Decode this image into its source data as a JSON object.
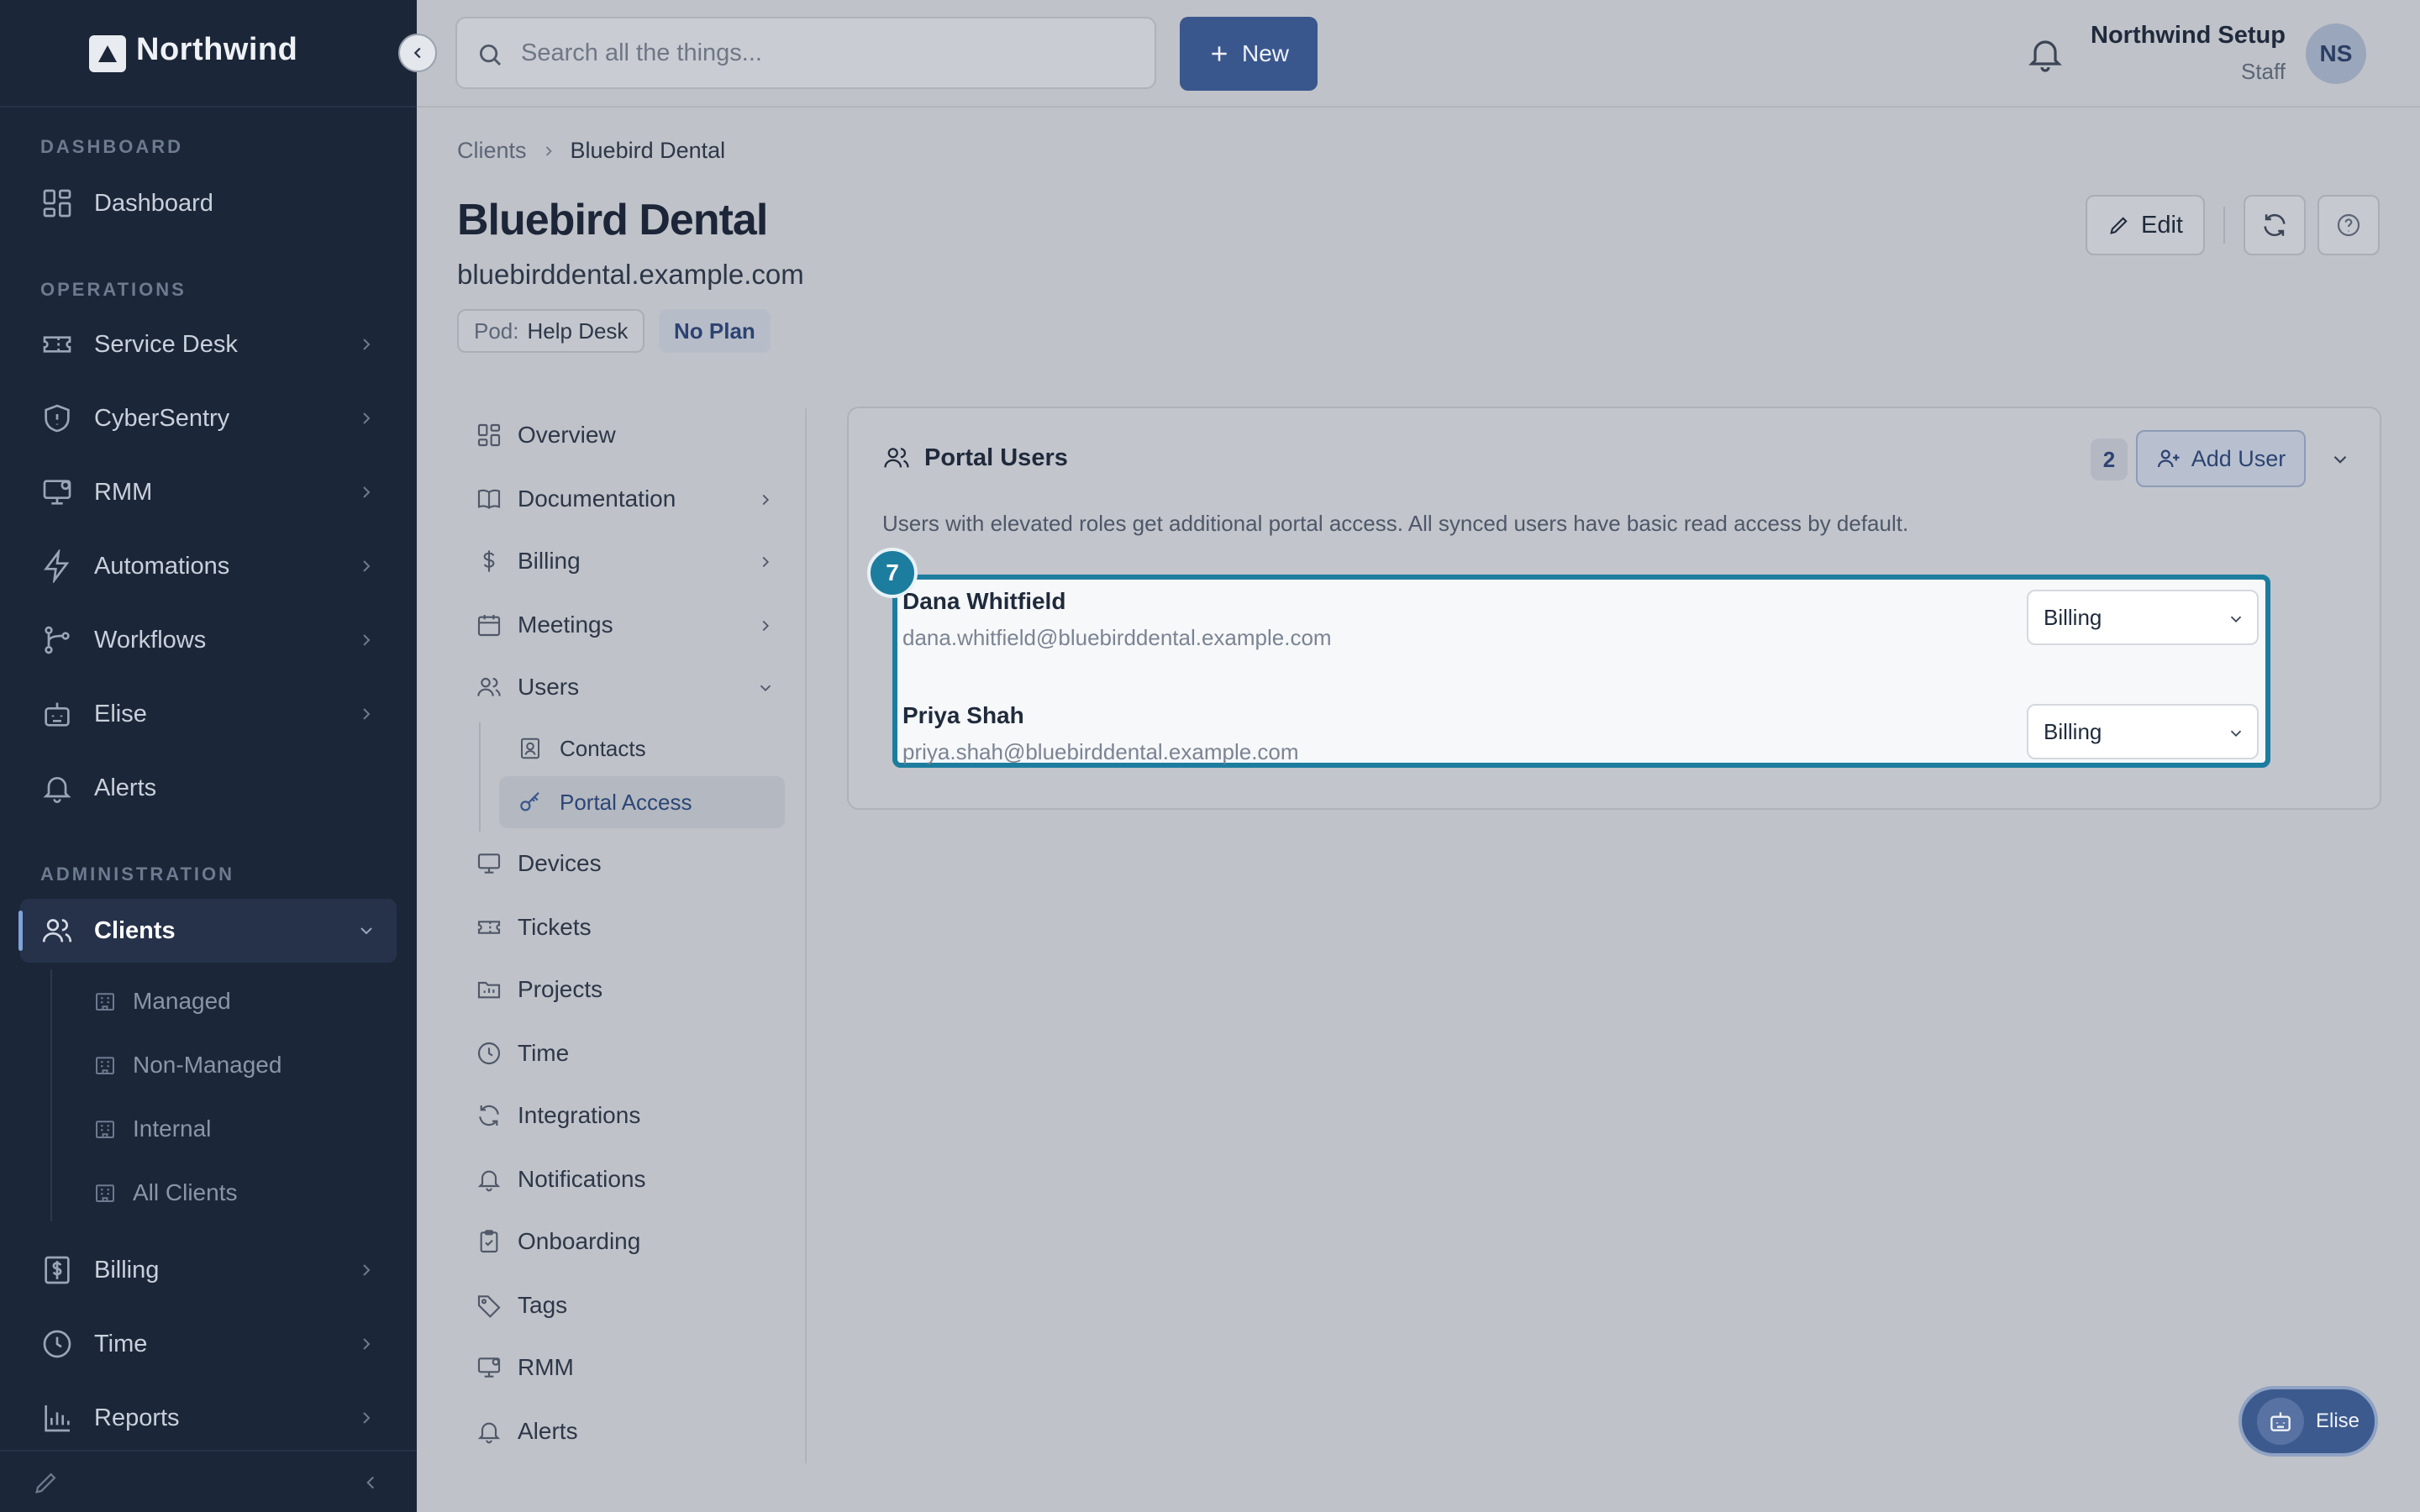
{
  "app": {
    "name": "Northwind"
  },
  "colors": {
    "sidebar_bg": "#1b2638",
    "accent": "#3a578d",
    "highlight": "#1d7d9e",
    "overlay_bg": "#bfc2c8"
  },
  "sidebar": {
    "sections": {
      "dashboard": "DASHBOARD",
      "operations": "OPERATIONS",
      "administration": "ADMINISTRATION"
    },
    "items": {
      "dashboard": {
        "label": "Dashboard",
        "icon": "dashboard-icon"
      },
      "service_desk": {
        "label": "Service Desk",
        "icon": "ticket-icon"
      },
      "cybersentry": {
        "label": "CyberSentry",
        "icon": "shield-icon"
      },
      "rmm": {
        "label": "RMM",
        "icon": "monitor-icon"
      },
      "automations": {
        "label": "Automations",
        "icon": "lightning-icon"
      },
      "workflows": {
        "label": "Workflows",
        "icon": "workflow-icon"
      },
      "elise": {
        "label": "Elise",
        "icon": "bot-icon"
      },
      "alerts": {
        "label": "Alerts",
        "icon": "bell-icon"
      },
      "clients": {
        "label": "Clients",
        "icon": "users-icon"
      },
      "billing": {
        "label": "Billing",
        "icon": "dollar-icon"
      },
      "time": {
        "label": "Time",
        "icon": "clock-icon"
      },
      "reports": {
        "label": "Reports",
        "icon": "chart-icon"
      }
    },
    "clients_sub": [
      "Managed",
      "Non-Managed",
      "Internal",
      "All Clients"
    ]
  },
  "topbar": {
    "search_placeholder": "Search all the things...",
    "new_label": "New",
    "user_name": "Northwind Setup",
    "user_role": "Staff",
    "avatar_initials": "NS"
  },
  "breadcrumb": [
    "Clients",
    "Bluebird Dental"
  ],
  "client": {
    "name": "Bluebird Dental",
    "domain": "bluebirddental.example.com",
    "pod_key": "Pod:",
    "pod_value": "Help Desk",
    "plan": "No Plan",
    "edit_label": "Edit"
  },
  "subnav": {
    "items": [
      "Overview",
      "Documentation",
      "Billing",
      "Meetings",
      "Users",
      "Devices",
      "Tickets",
      "Projects",
      "Time",
      "Integrations",
      "Notifications",
      "Onboarding",
      "Tags",
      "RMM",
      "Alerts"
    ],
    "users_sub": [
      "Contacts",
      "Portal Access"
    ]
  },
  "portal_users": {
    "title": "Portal Users",
    "count": "2",
    "add_label": "Add User",
    "description": "Users with elevated roles get additional portal access. All synced users have basic read access by default.",
    "step": "7",
    "users": [
      {
        "name": "Dana Whitfield",
        "email": "dana.whitfield@bluebirddental.example.com",
        "role": "Billing"
      },
      {
        "name": "Priya Shah",
        "email": "priya.shah@bluebirddental.example.com",
        "role": "Billing"
      }
    ]
  },
  "fab": {
    "label": "Elise"
  }
}
